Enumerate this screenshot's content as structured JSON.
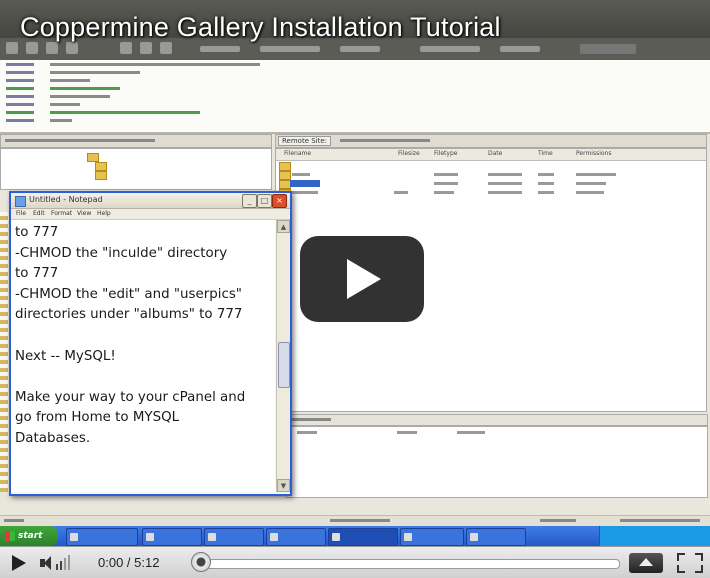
{
  "video": {
    "title": "Coppermine Gallery Installation Tutorial"
  },
  "notepad": {
    "window_title": "Untitled - Notepad",
    "menu": [
      "File",
      "Edit",
      "Format",
      "View",
      "Help"
    ],
    "text": "to 777\n-CHMOD the \"inculde\" directory\nto 777\n-CHMOD the \"edit\" and \"userpics\"\ndirectories under \"albums\" to 777\n\nNext -- MySQL!\n\nMake your way to your cPanel and\ngo from Home to MYSQL\nDatabases."
  },
  "ftp": {
    "remote_tab": "Remote Site:",
    "remote_columns": [
      "Filename",
      "Filesize",
      "Filetype",
      "Date",
      "Time",
      "Permissions"
    ]
  },
  "taskbar": {
    "start_label": "start"
  },
  "controls": {
    "current_time": "0:00",
    "separator": " / ",
    "duration": "5:12",
    "progress_fraction": 0.0
  },
  "icons": {
    "play": "play-icon",
    "volume": "volume-icon",
    "menu": "menu-icon",
    "fullscreen": "fullscreen-icon",
    "big_play": "big-play-icon"
  }
}
